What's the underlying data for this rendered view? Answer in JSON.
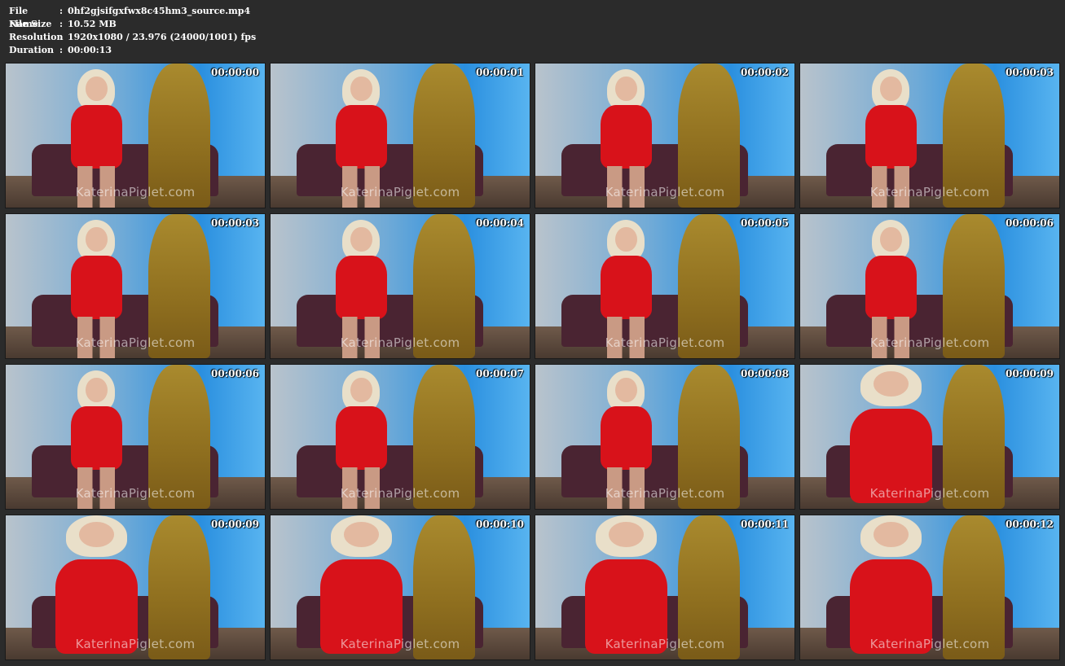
{
  "meta": [
    {
      "key": "File Name",
      "value": "0hf2gjsifgxfwx8c45hm3_source.mp4"
    },
    {
      "key": "File Size",
      "value": "10.52 MB"
    },
    {
      "key": "Resolution",
      "value": "1920x1080 / 23.976 (24000/1001) fps"
    },
    {
      "key": "Duration",
      "value": "00:00:13"
    }
  ],
  "separator": ":",
  "watermark": "KaterinaPiglet.com",
  "thumbnails": [
    {
      "timestamp": "00:00:00",
      "framing": "wide"
    },
    {
      "timestamp": "00:00:01",
      "framing": "wide"
    },
    {
      "timestamp": "00:00:02",
      "framing": "wide"
    },
    {
      "timestamp": "00:00:03",
      "framing": "wide"
    },
    {
      "timestamp": "00:00:03",
      "framing": "wide"
    },
    {
      "timestamp": "00:00:04",
      "framing": "wide"
    },
    {
      "timestamp": "00:00:05",
      "framing": "wide"
    },
    {
      "timestamp": "00:00:06",
      "framing": "wide"
    },
    {
      "timestamp": "00:00:06",
      "framing": "wide"
    },
    {
      "timestamp": "00:00:07",
      "framing": "wide"
    },
    {
      "timestamp": "00:00:08",
      "framing": "wide"
    },
    {
      "timestamp": "00:00:09",
      "framing": "close"
    },
    {
      "timestamp": "00:00:09",
      "framing": "close"
    },
    {
      "timestamp": "00:00:10",
      "framing": "close"
    },
    {
      "timestamp": "00:00:11",
      "framing": "close"
    },
    {
      "timestamp": "00:00:12",
      "framing": "close"
    }
  ]
}
